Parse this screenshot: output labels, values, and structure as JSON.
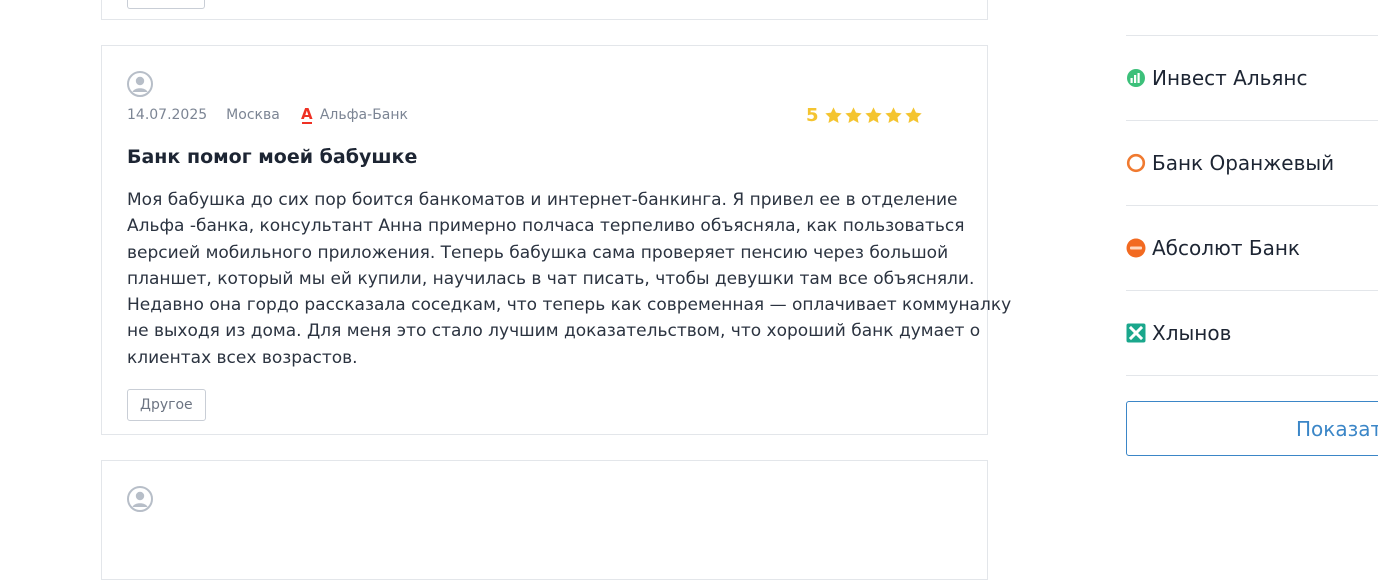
{
  "reviews": [
    {
      "date": "14.07.2025",
      "city": "Москва",
      "bank": "Альфа-Банк",
      "bank_logo_letter": "А",
      "rating": "5",
      "stars": 5,
      "title": "Банк помог моей бабушке",
      "text_lines": [
        "Моя бабушка до сих пор боится банкоматов и интернет-банкинга. Я привел ее в отделение",
        "Альфа -банка, консультант Анна примерно полчаса терпеливо объясняла, как пользоваться",
        "версией мобильного приложения. Теперь бабушка сама проверяет пенсию через большой",
        "планшет, который мы ей купили, научилась в чат писать, чтобы девушки там все объясняли.",
        "Недавно она гордо рассказала соседкам, что теперь как современная — оплачивает коммуналку",
        "не выходя из дома. Для меня это стало лучшим доказательством, что хороший банк думает о",
        "клиентах всех возрастов."
      ],
      "tag": "Другое"
    }
  ],
  "sidebar": {
    "banks": [
      {
        "name": "Инвест Альянс",
        "logo": "invest-alliance-logo",
        "color": "#3cc07a"
      },
      {
        "name": "Банк Оранжевый",
        "logo": "orange-ring-logo",
        "color": "#f07a30"
      },
      {
        "name": "Абсолют Банк",
        "logo": "absolut-logo",
        "color": "#f26a21"
      },
      {
        "name": "Хлынов",
        "logo": "khlynov-logo",
        "color": "#1aa78c"
      }
    ],
    "show_more": "Показать"
  },
  "colors": {
    "star": "#f4c430",
    "accent": "#3b86c7",
    "alfa_red": "#ef3124",
    "border": "#e3e6ea"
  }
}
